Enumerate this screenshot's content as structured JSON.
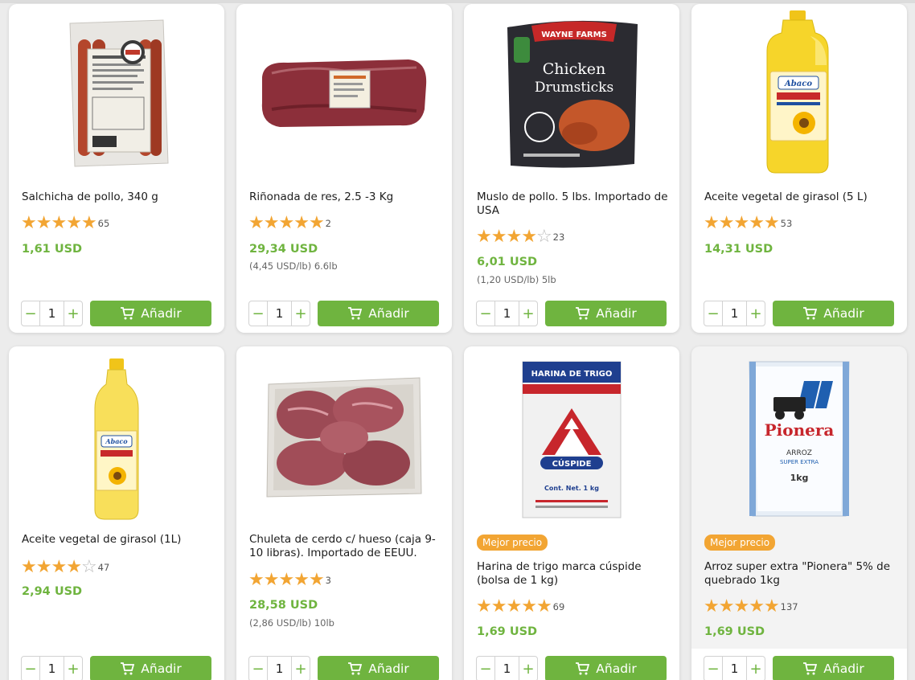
{
  "colors": {
    "accent_green": "#6fb43f",
    "star_orange": "#f2a533",
    "badge_orange": "#f2a533"
  },
  "add_label": "Añadir",
  "products": [
    {
      "name": "Salchicha de pollo, 340 g",
      "rating": 5,
      "reviews": "65",
      "price": "1,61 USD",
      "unit_price": "",
      "qty": "1",
      "badge": "",
      "icon": "sausage-pack-image"
    },
    {
      "name": "Riñonada de res, 2.5 -3 Kg",
      "rating": 5,
      "reviews": "2",
      "price": "29,34 USD",
      "unit_price": "(4,45 USD/lb) 6.6lb",
      "qty": "1",
      "badge": "",
      "icon": "beef-loin-image"
    },
    {
      "name": "Muslo de pollo. 5 lbs. Importado de USA",
      "rating": 4,
      "reviews": "23",
      "price": "6,01 USD",
      "unit_price": "(1,20 USD/lb) 5lb",
      "qty": "1",
      "badge": "",
      "icon": "chicken-drumsticks-bag-image",
      "pack_brand": "WAYNE FARMS",
      "pack_text_1": "Chicken",
      "pack_text_2": "Drumsticks"
    },
    {
      "name": "Aceite vegetal de girasol (5 L)",
      "rating": 5,
      "reviews": "53",
      "price": "14,31 USD",
      "unit_price": "",
      "qty": "1",
      "badge": "",
      "icon": "oil-jug-image",
      "pack_brand": "Abaco"
    },
    {
      "name": "Aceite vegetal de girasol (1L)",
      "rating": 4,
      "reviews": "47",
      "price": "2,94 USD",
      "unit_price": "",
      "qty": "1",
      "badge": "",
      "icon": "oil-bottle-image",
      "pack_brand": "Abaco"
    },
    {
      "name": "Chuleta de cerdo c/ hueso (caja 9-10 libras). Importado de EEUU.",
      "rating": 5,
      "reviews": "3",
      "price": "28,58 USD",
      "unit_price": "(2,86 USD/lb) 10lb",
      "qty": "1",
      "badge": "",
      "icon": "pork-chops-box-image"
    },
    {
      "name": "Harina de trigo marca cúspide (bolsa de 1 kg)",
      "rating": 5,
      "reviews": "69",
      "price": "1,69 USD",
      "unit_price": "",
      "qty": "1",
      "badge": "Mejor precio",
      "icon": "flour-bag-image",
      "pack_title": "HARINA DE TRIGO",
      "pack_brand": "CÚSPIDE",
      "pack_net": "Cont. Net. 1 kg"
    },
    {
      "name": "Arroz super extra \"Pionera\" 5% de quebrado 1kg",
      "rating": 5,
      "reviews": "137",
      "price": "1,69 USD",
      "unit_price": "",
      "qty": "1",
      "badge": "Mejor precio",
      "icon": "rice-bag-image",
      "pack_brand": "Pionera",
      "pack_text_1": "ARROZ",
      "pack_text_2": "SUPER EXTRA",
      "pack_net": "1kg"
    }
  ]
}
